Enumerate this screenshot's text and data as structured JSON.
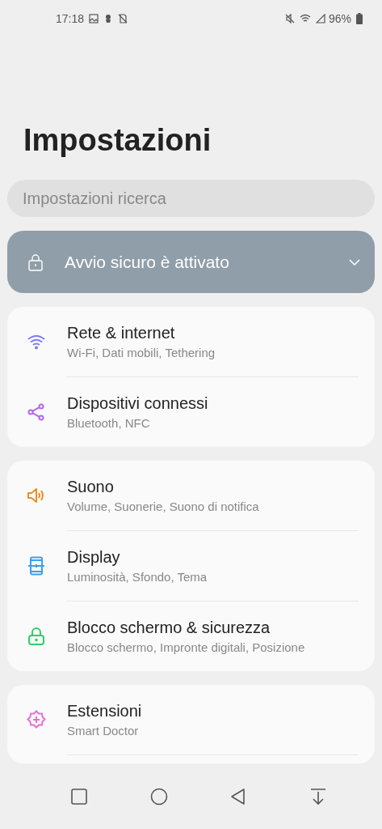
{
  "status_bar": {
    "time": "17:18",
    "battery": "96%"
  },
  "title": "Impostazioni",
  "search": {
    "placeholder": "Impostazioni ricerca"
  },
  "banner": {
    "text": "Avvio sicuro è attivato",
    "expanded": false
  },
  "groups": [
    {
      "items": [
        {
          "kind": "wifi",
          "color": "#7b7cf4",
          "title": "Rete & internet",
          "subtitle": "Wi-Fi, Dati mobili, Tethering"
        },
        {
          "kind": "share",
          "color": "#b36ae8",
          "title": "Dispositivi connessi",
          "subtitle": "Bluetooth, NFC"
        }
      ]
    },
    {
      "items": [
        {
          "kind": "sound",
          "color": "#f28c1e",
          "title": "Suono",
          "subtitle": "Volume, Suonerie, Suono di notifica"
        },
        {
          "kind": "display",
          "color": "#3aa0f0",
          "title": "Display",
          "subtitle": "Luminosità, Sfondo, Tema"
        },
        {
          "kind": "lock",
          "color": "#2ccf6a",
          "title": "Blocco schermo & sicurezza",
          "subtitle": "Blocco schermo, Impronte digitali, Posizione"
        }
      ]
    },
    {
      "items": [
        {
          "kind": "gear",
          "color": "#e46fd8",
          "title": "Estensioni",
          "subtitle": "Smart Doctor"
        }
      ]
    }
  ]
}
